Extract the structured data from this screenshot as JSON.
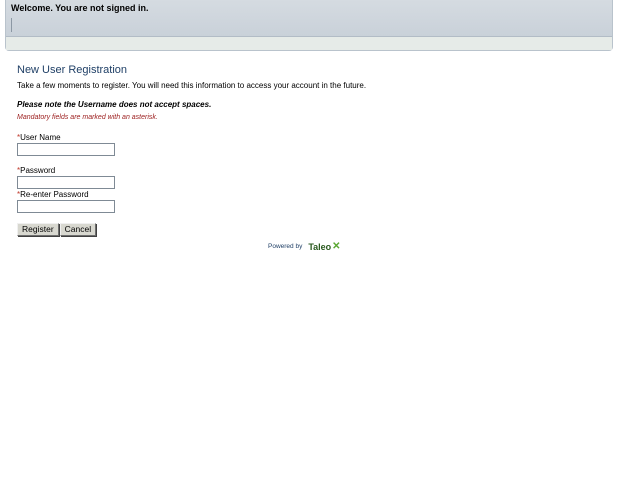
{
  "header": {
    "welcome_text": "Welcome. You are not signed in."
  },
  "page": {
    "title": "New User Registration",
    "intro": "Take a few moments to register.  You will need this information to access your account in the future.",
    "note": "Please note the Username does not accept spaces.",
    "mandatory": "Mandatory fields are marked with an asterisk."
  },
  "form": {
    "asterisk": "*",
    "fields": [
      {
        "label": "User Name",
        "value": ""
      },
      {
        "label": "Password",
        "value": ""
      },
      {
        "label": "Re-enter Password",
        "value": ""
      }
    ],
    "register_label": "Register",
    "cancel_label": "Cancel"
  },
  "footer": {
    "powered_by": "Powered by",
    "logo_text": "Taleo",
    "logo_mark": "✕"
  },
  "colors": {
    "title": "#1f3f66",
    "mandatory_text": "#9b1c1c",
    "asterisk": "#c0392b",
    "header_bg": "#c9d1d9",
    "logo_green": "#5aa832"
  }
}
